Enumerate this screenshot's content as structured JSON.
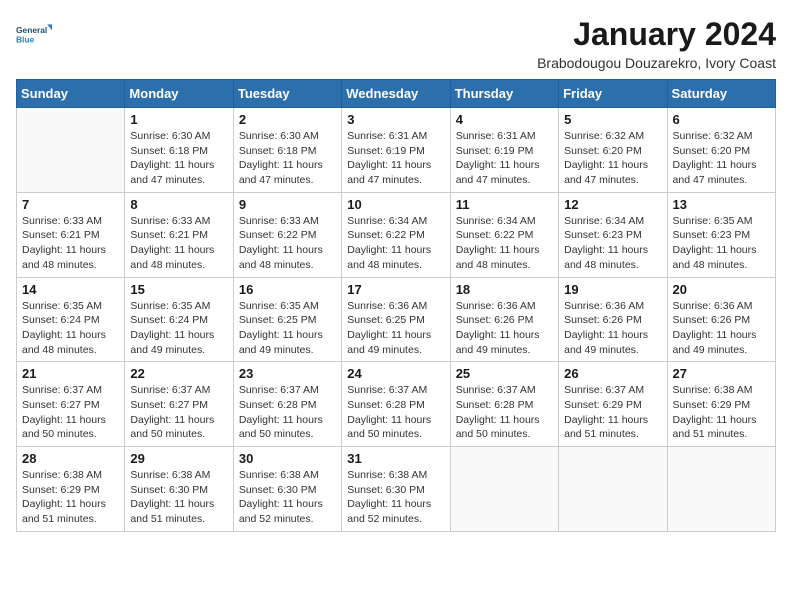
{
  "logo": {
    "line1": "General",
    "line2": "Blue"
  },
  "title": "January 2024",
  "subtitle": "Brabodougou Douzarekro, Ivory Coast",
  "days_of_week": [
    "Sunday",
    "Monday",
    "Tuesday",
    "Wednesday",
    "Thursday",
    "Friday",
    "Saturday"
  ],
  "weeks": [
    [
      {
        "day": "",
        "info": ""
      },
      {
        "day": "1",
        "info": "Sunrise: 6:30 AM\nSunset: 6:18 PM\nDaylight: 11 hours\nand 47 minutes."
      },
      {
        "day": "2",
        "info": "Sunrise: 6:30 AM\nSunset: 6:18 PM\nDaylight: 11 hours\nand 47 minutes."
      },
      {
        "day": "3",
        "info": "Sunrise: 6:31 AM\nSunset: 6:19 PM\nDaylight: 11 hours\nand 47 minutes."
      },
      {
        "day": "4",
        "info": "Sunrise: 6:31 AM\nSunset: 6:19 PM\nDaylight: 11 hours\nand 47 minutes."
      },
      {
        "day": "5",
        "info": "Sunrise: 6:32 AM\nSunset: 6:20 PM\nDaylight: 11 hours\nand 47 minutes."
      },
      {
        "day": "6",
        "info": "Sunrise: 6:32 AM\nSunset: 6:20 PM\nDaylight: 11 hours\nand 47 minutes."
      }
    ],
    [
      {
        "day": "7",
        "info": "Sunrise: 6:33 AM\nSunset: 6:21 PM\nDaylight: 11 hours\nand 48 minutes."
      },
      {
        "day": "8",
        "info": "Sunrise: 6:33 AM\nSunset: 6:21 PM\nDaylight: 11 hours\nand 48 minutes."
      },
      {
        "day": "9",
        "info": "Sunrise: 6:33 AM\nSunset: 6:22 PM\nDaylight: 11 hours\nand 48 minutes."
      },
      {
        "day": "10",
        "info": "Sunrise: 6:34 AM\nSunset: 6:22 PM\nDaylight: 11 hours\nand 48 minutes."
      },
      {
        "day": "11",
        "info": "Sunrise: 6:34 AM\nSunset: 6:22 PM\nDaylight: 11 hours\nand 48 minutes."
      },
      {
        "day": "12",
        "info": "Sunrise: 6:34 AM\nSunset: 6:23 PM\nDaylight: 11 hours\nand 48 minutes."
      },
      {
        "day": "13",
        "info": "Sunrise: 6:35 AM\nSunset: 6:23 PM\nDaylight: 11 hours\nand 48 minutes."
      }
    ],
    [
      {
        "day": "14",
        "info": "Sunrise: 6:35 AM\nSunset: 6:24 PM\nDaylight: 11 hours\nand 48 minutes."
      },
      {
        "day": "15",
        "info": "Sunrise: 6:35 AM\nSunset: 6:24 PM\nDaylight: 11 hours\nand 49 minutes."
      },
      {
        "day": "16",
        "info": "Sunrise: 6:35 AM\nSunset: 6:25 PM\nDaylight: 11 hours\nand 49 minutes."
      },
      {
        "day": "17",
        "info": "Sunrise: 6:36 AM\nSunset: 6:25 PM\nDaylight: 11 hours\nand 49 minutes."
      },
      {
        "day": "18",
        "info": "Sunrise: 6:36 AM\nSunset: 6:26 PM\nDaylight: 11 hours\nand 49 minutes."
      },
      {
        "day": "19",
        "info": "Sunrise: 6:36 AM\nSunset: 6:26 PM\nDaylight: 11 hours\nand 49 minutes."
      },
      {
        "day": "20",
        "info": "Sunrise: 6:36 AM\nSunset: 6:26 PM\nDaylight: 11 hours\nand 49 minutes."
      }
    ],
    [
      {
        "day": "21",
        "info": "Sunrise: 6:37 AM\nSunset: 6:27 PM\nDaylight: 11 hours\nand 50 minutes."
      },
      {
        "day": "22",
        "info": "Sunrise: 6:37 AM\nSunset: 6:27 PM\nDaylight: 11 hours\nand 50 minutes."
      },
      {
        "day": "23",
        "info": "Sunrise: 6:37 AM\nSunset: 6:28 PM\nDaylight: 11 hours\nand 50 minutes."
      },
      {
        "day": "24",
        "info": "Sunrise: 6:37 AM\nSunset: 6:28 PM\nDaylight: 11 hours\nand 50 minutes."
      },
      {
        "day": "25",
        "info": "Sunrise: 6:37 AM\nSunset: 6:28 PM\nDaylight: 11 hours\nand 50 minutes."
      },
      {
        "day": "26",
        "info": "Sunrise: 6:37 AM\nSunset: 6:29 PM\nDaylight: 11 hours\nand 51 minutes."
      },
      {
        "day": "27",
        "info": "Sunrise: 6:38 AM\nSunset: 6:29 PM\nDaylight: 11 hours\nand 51 minutes."
      }
    ],
    [
      {
        "day": "28",
        "info": "Sunrise: 6:38 AM\nSunset: 6:29 PM\nDaylight: 11 hours\nand 51 minutes."
      },
      {
        "day": "29",
        "info": "Sunrise: 6:38 AM\nSunset: 6:30 PM\nDaylight: 11 hours\nand 51 minutes."
      },
      {
        "day": "30",
        "info": "Sunrise: 6:38 AM\nSunset: 6:30 PM\nDaylight: 11 hours\nand 52 minutes."
      },
      {
        "day": "31",
        "info": "Sunrise: 6:38 AM\nSunset: 6:30 PM\nDaylight: 11 hours\nand 52 minutes."
      },
      {
        "day": "",
        "info": ""
      },
      {
        "day": "",
        "info": ""
      },
      {
        "day": "",
        "info": ""
      }
    ]
  ]
}
